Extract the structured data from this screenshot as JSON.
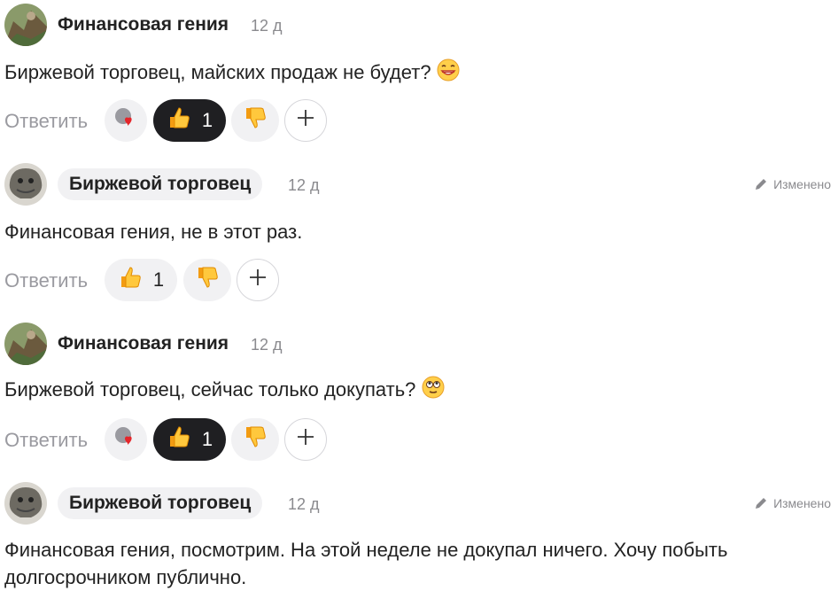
{
  "comments": [
    {
      "author": "Финансовая гения",
      "time": "12 д",
      "text": "Биржевой торговец, майских продаж не будет?",
      "emoji": "grin-face-icon",
      "reply": "Ответить",
      "like_count": "1"
    },
    {
      "author": "Биржевой торговец",
      "time": "12 д",
      "edited": "Изменено",
      "text": "Финансовая гения, не в этот раз.",
      "reply": "Ответить",
      "like_count": "1"
    },
    {
      "author": "Финансовая гения",
      "time": "12 д",
      "text": "Биржевой торговец, сейчас только докупать?",
      "emoji": "rolling-eyes-face-icon",
      "reply": "Ответить",
      "like_count": "1"
    },
    {
      "author": "Биржевой торговец",
      "time": "12 д",
      "edited": "Изменено",
      "text": "Финансовая гения, посмотрим. На этой неделе не докупал ничего. Хочу побыть долгосрочником публично."
    }
  ],
  "colors": {
    "accent_dark": "#1f1f22",
    "chip": "#f1f1f3",
    "muted": "#8a8a8e"
  }
}
